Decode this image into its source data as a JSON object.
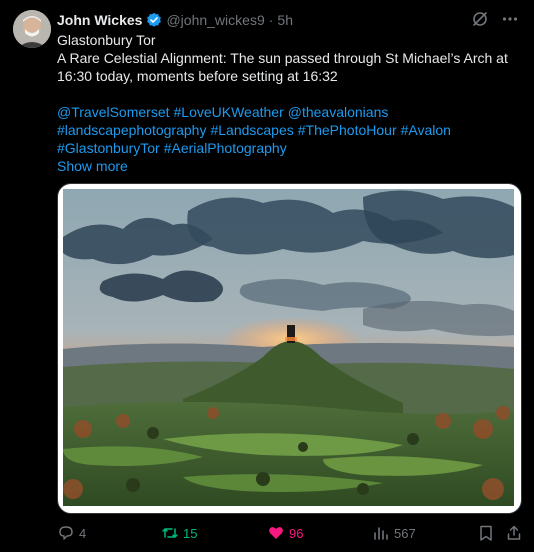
{
  "author": {
    "name": "John Wickes",
    "handle": "@john_wickes9",
    "separator": "·",
    "time": "5h"
  },
  "tweet": {
    "lines": [
      "Glastonbury Tor",
      "A Rare Celestial Alignment: The sun passed through St Michael’s Arch at",
      "16:30 today, moments before setting at 16:32"
    ],
    "hashtag_lines": [
      [
        "@TravelSomerset",
        "#LoveUKWeather",
        "@theavalonians"
      ],
      [
        "#landscapephotography",
        "#Landscapes",
        "#ThePhotoHour",
        "#Avalon"
      ],
      [
        "#GlastonburyTor",
        "#AerialPhotography"
      ]
    ],
    "show_more": "Show more"
  },
  "stats": {
    "replies": "4",
    "retweets": "15",
    "likes": "96",
    "views": "567"
  },
  "colors": {
    "background": "#000000",
    "text": "#e7e9ea",
    "muted": "#71767b",
    "link": "#1d9bf0",
    "retweet": "#00ba7c",
    "like": "#f91880"
  },
  "icons": {
    "verified": "verified-badge-icon",
    "grok": "grok-icon",
    "more": "more-icon",
    "reply": "reply-icon",
    "retweet": "retweet-icon",
    "like": "heart-icon",
    "views": "views-icon",
    "bookmark": "bookmark-icon",
    "share": "share-icon"
  }
}
